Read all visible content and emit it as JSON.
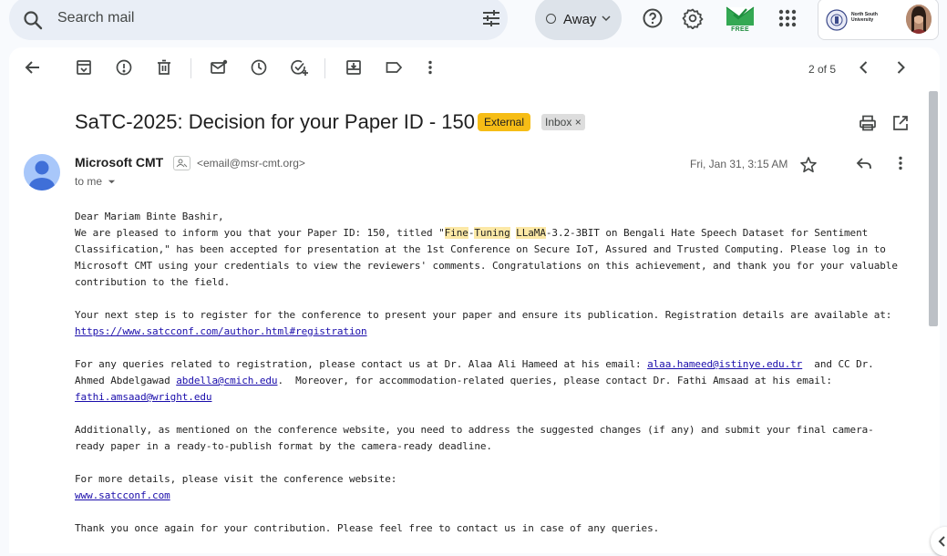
{
  "search": {
    "placeholder": "Search mail",
    "icon": "search-icon",
    "filter_icon": "tune-icon"
  },
  "status": {
    "label": "Away"
  },
  "header_icons": [
    "help-icon",
    "settings-icon",
    "apps-grid-icon"
  ],
  "addon": {
    "badge": "FREE"
  },
  "account": {
    "org_name": "North South University"
  },
  "toolbar": {
    "pager": "2 of 5",
    "icons": [
      "back-arrow-icon",
      "archive-icon",
      "report-spam-icon",
      "delete-icon",
      "mark-unread-icon",
      "snooze-icon",
      "add-task-icon",
      "move-to-icon",
      "label-icon",
      "more-vert-icon",
      "newer-icon",
      "older-icon"
    ]
  },
  "email": {
    "subject": "SaTC-2025: Decision for your Paper ID - 150",
    "labels": {
      "external": "External",
      "inbox": "Inbox",
      "inbox_remove": "×"
    },
    "sender_name": "Microsoft CMT",
    "sender_email": "<email@msr-cmt.org>",
    "to": "to me",
    "date": "Fri, Jan 31, 3:15 AM",
    "body": {
      "greeting": "Dear Mariam Binte Bashir,",
      "p1_l1_a": "We are pleased to inform you that your Paper ID: 150, titled \"",
      "hl_fine": "Fine",
      "dash": "-",
      "hl_tuning": "Tuning",
      "space": " ",
      "hl_llama": "LLaMA",
      "p1_l1_b": "-3.2-3BIT on Bengali Hate Speech Dataset for Sentiment",
      "p1_l2": "Classification,\" has been accepted for presentation at the 1st Conference on Secure IoT, Assured and Trusted Computing. Please log in to",
      "p1_l3": "Microsoft CMT using your credentials to view the reviewers' comments. Congratulations on this achievement, and thank you for your valuable",
      "p1_l4": "contribution to the field.",
      "p2_l1": "Your next step is to register for the conference to present your paper and ensure its publication. Registration details are available at:",
      "p2_link": "https://www.satcconf.com/author.html#registration",
      "p3_l1": "For any queries related to registration, please contact us at Dr. Alaa Ali Hameed at his email: ",
      "p3_email1": "alaa.hameed@istinye.edu.tr",
      "p3_l1_end": "  and CC Dr.",
      "p3_l2": "Ahmed Abdelgawad ",
      "p3_email2": "abdella@cmich.edu",
      "p3_l2_end": ".  Moreover, for accommodation-related queries, please contact Dr. Fathi Amsaad at his email:",
      "p3_email3": "fathi.amsaad@wright.edu",
      "p4_l1": "Additionally, as mentioned on the conference website, you need to address the suggested changes (if any) and submit your final camera-",
      "p4_l2": "ready paper in a ready-to-publish format by the camera-ready deadline.",
      "p5_l1": "For more details, please visit the conference website:",
      "p5_link": "www.satcconf.com",
      "p6_l1": "Thank you once again for your contribution. Please feel free to contact us in case of any queries."
    }
  },
  "colors": {
    "external_badge": "#f6bd16",
    "highlight": "#fce8a6",
    "link": "#1a0dab",
    "free_badge": "#1e8e3e"
  }
}
